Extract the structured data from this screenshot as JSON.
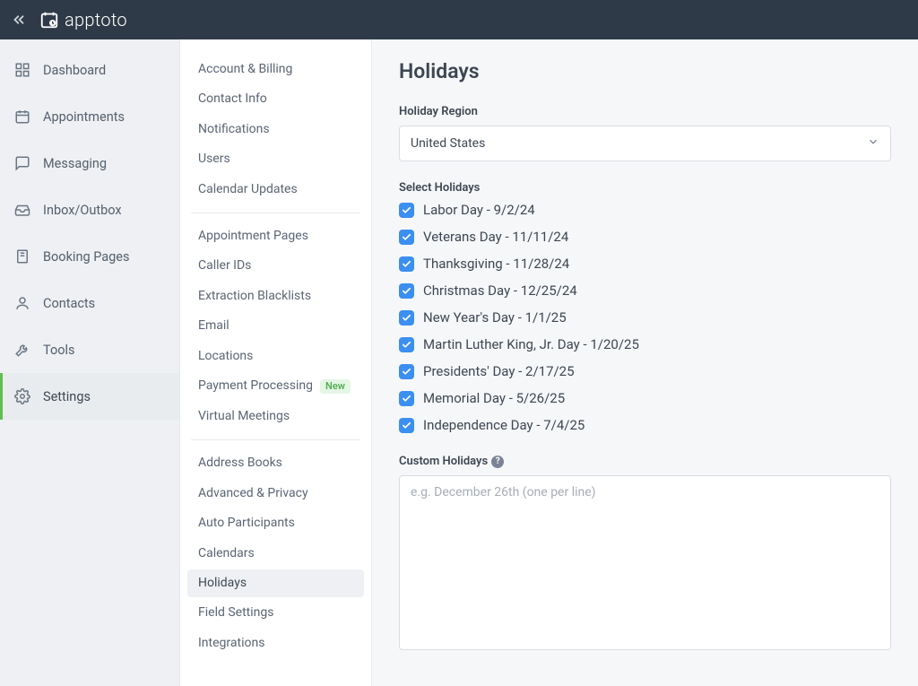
{
  "brand": "apptoto",
  "sidebar": {
    "items": [
      {
        "id": "dashboard",
        "label": "Dashboard"
      },
      {
        "id": "appointments",
        "label": "Appointments"
      },
      {
        "id": "messaging",
        "label": "Messaging"
      },
      {
        "id": "inbox-outbox",
        "label": "Inbox/Outbox"
      },
      {
        "id": "booking-pages",
        "label": "Booking Pages"
      },
      {
        "id": "contacts",
        "label": "Contacts"
      },
      {
        "id": "tools",
        "label": "Tools"
      },
      {
        "id": "settings",
        "label": "Settings"
      }
    ]
  },
  "subnav": {
    "group1": [
      "Account & Billing",
      "Contact Info",
      "Notifications",
      "Users",
      "Calendar Updates"
    ],
    "group2": [
      "Appointment Pages",
      "Caller IDs",
      "Extraction Blacklists",
      "Email",
      "Locations",
      "Payment Processing",
      "Virtual Meetings"
    ],
    "group3": [
      "Address Books",
      "Advanced & Privacy",
      "Auto Participants",
      "Calendars",
      "Holidays",
      "Field Settings",
      "Integrations"
    ],
    "badge_new": "New"
  },
  "page": {
    "title": "Holidays",
    "region_label": "Holiday Region",
    "region_value": "United States",
    "select_label": "Select Holidays",
    "holidays": [
      "Labor Day - 9/2/24",
      "Veterans Day - 11/11/24",
      "Thanksgiving - 11/28/24",
      "Christmas Day - 12/25/24",
      "New Year's Day - 1/1/25",
      "Martin Luther King, Jr. Day - 1/20/25",
      "Presidents' Day - 2/17/25",
      "Memorial Day - 5/26/25",
      "Independence Day - 7/4/25"
    ],
    "custom_label": "Custom Holidays",
    "custom_placeholder": "e.g. December 26th (one per line)"
  }
}
